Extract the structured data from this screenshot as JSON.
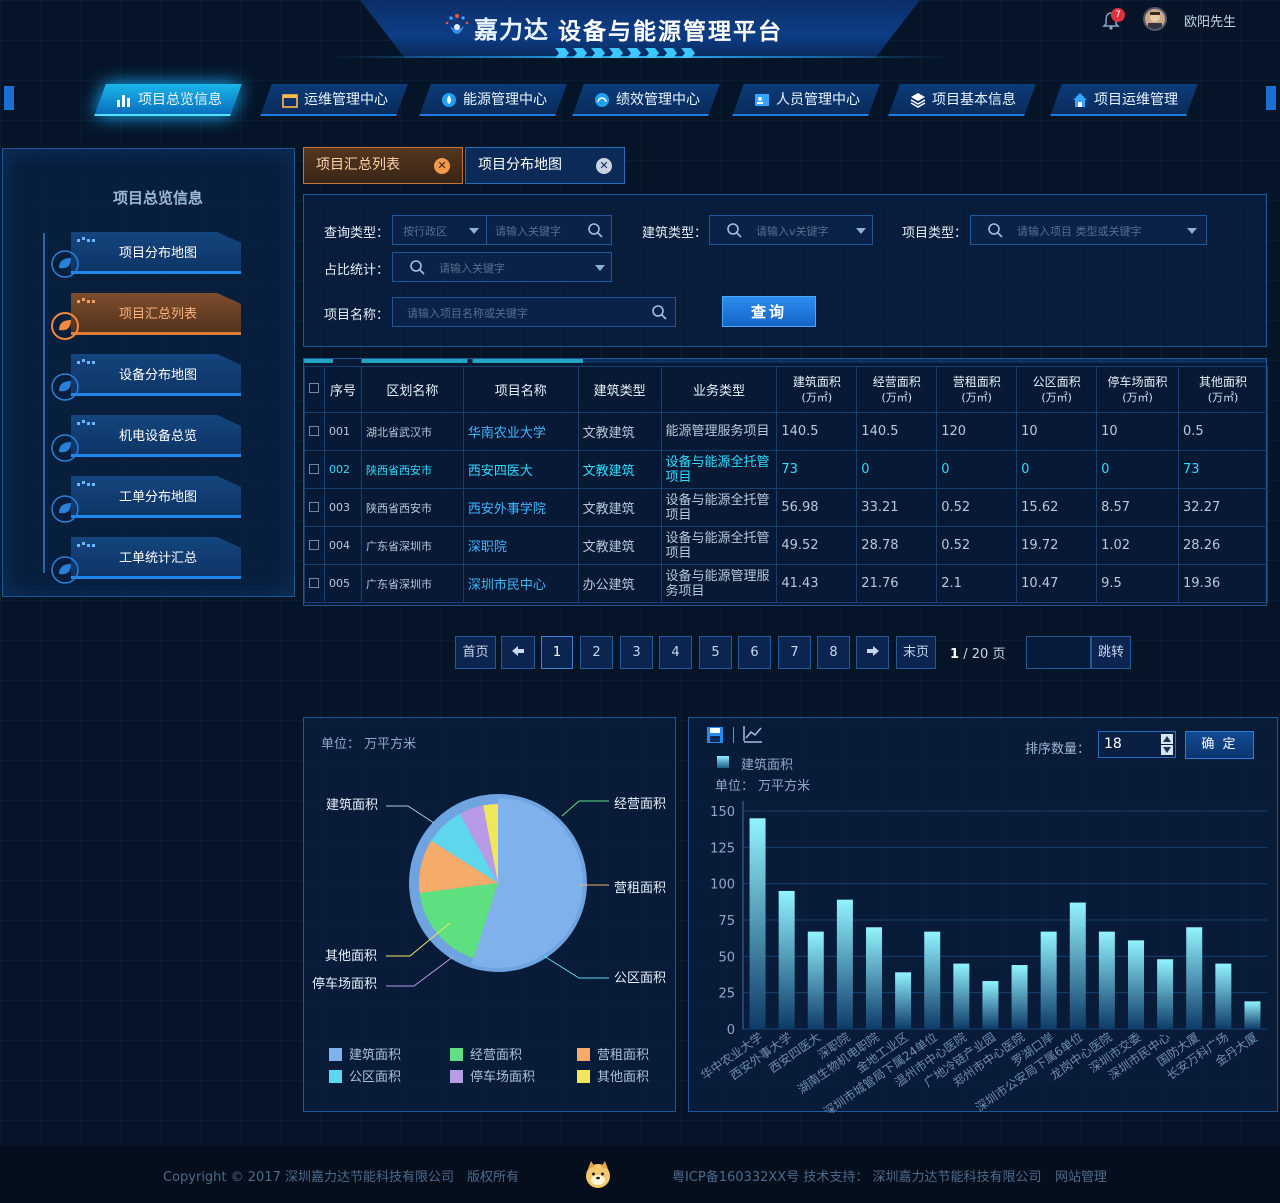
{
  "header": {
    "brand": "嘉力达",
    "title": "设备与能源管理平台",
    "notification_count": "7",
    "username": "欧阳先生"
  },
  "nav": {
    "tabs": [
      {
        "label": "项目总览信息",
        "icon": "chart-bars-icon",
        "active": true
      },
      {
        "label": "运维管理中心",
        "icon": "calendar-icon",
        "active": false
      },
      {
        "label": "能源管理中心",
        "icon": "droplet-icon",
        "active": false
      },
      {
        "label": "绩效管理中心",
        "icon": "gauge-icon",
        "active": false
      },
      {
        "label": "人员管理中心",
        "icon": "person-card-icon",
        "active": false
      },
      {
        "label": "项目基本信息",
        "icon": "layers-icon",
        "active": false
      },
      {
        "label": "项目运维管理",
        "icon": "home-icon",
        "active": false
      }
    ]
  },
  "sidebar": {
    "title": "项目总览信息",
    "items": [
      {
        "label": "项目分布地图",
        "active": false
      },
      {
        "label": "项目汇总列表",
        "active": true
      },
      {
        "label": "设备分布地图",
        "active": false
      },
      {
        "label": "机电设备总览",
        "active": false
      },
      {
        "label": "工单分布地图",
        "active": false
      },
      {
        "label": "工单统计汇总",
        "active": false
      }
    ]
  },
  "content_tabs": [
    {
      "label": "项目汇总列表",
      "active": true
    },
    {
      "label": "项目分布地图",
      "active": false
    }
  ],
  "filters": {
    "query_type_label": "查询类型：",
    "region_placeholder": "按行政区",
    "keyword_placeholder": "请输入关键字",
    "building_type_label": "建筑类型：",
    "building_type_placeholder": "请输入v关键字",
    "project_type_label": "项目类型：",
    "project_type_placeholder": "请输入项目 类型或关键字",
    "ratio_label": "占比统计：",
    "ratio_placeholder": "请输入关键字",
    "name_label": "项目名称：",
    "name_placeholder": "请输入项目名称或关键字",
    "query_button": "查询"
  },
  "table": {
    "headers": [
      "序号",
      "区划名称",
      "项目名称",
      "建筑类型",
      "业务类型"
    ],
    "area_headers": [
      {
        "name": "建筑面积",
        "unit": "(万㎡)"
      },
      {
        "name": "经营面积",
        "unit": "(万㎡)"
      },
      {
        "name": "营租面积",
        "unit": "(万㎡)"
      },
      {
        "name": "公区面积",
        "unit": "(万㎡)"
      },
      {
        "name": "停车场面积",
        "unit": "(万㎡)"
      },
      {
        "name": "其他面积",
        "unit": "(万㎡)"
      }
    ],
    "rows": [
      {
        "no": "001",
        "region": "湖北省武汉市",
        "name": "华南农业大学",
        "building": "文教建筑",
        "business": "能源管理服务项目",
        "a1": "140.5",
        "a2": "140.5",
        "a3": "120",
        "a4": "10",
        "a5": "10",
        "a6": "0.5",
        "highlight": false
      },
      {
        "no": "002",
        "region": "陕西省西安市",
        "name": "西安四医大",
        "building": "文教建筑",
        "business": "设备与能源全托管项目",
        "a1": "73",
        "a2": "0",
        "a3": "0",
        "a4": "0",
        "a5": "0",
        "a6": "73",
        "highlight": true
      },
      {
        "no": "003",
        "region": "陕西省西安市",
        "name": "西安外事学院",
        "building": "文教建筑",
        "business": "设备与能源全托管项目",
        "a1": "56.98",
        "a2": "33.21",
        "a3": "0.52",
        "a4": "15.62",
        "a5": "8.57",
        "a6": "32.27",
        "highlight": false
      },
      {
        "no": "004",
        "region": "广东省深圳市",
        "name": "深职院",
        "building": "文教建筑",
        "business": "设备与能源全托管项目",
        "a1": "49.52",
        "a2": "28.78",
        "a3": "0.52",
        "a4": "19.72",
        "a5": "1.02",
        "a6": "28.26",
        "highlight": false
      },
      {
        "no": "005",
        "region": "广东省深圳市",
        "name": "深圳市民中心",
        "building": "办公建筑",
        "business": "设备与能源管理服务项目",
        "a1": "41.43",
        "a2": "21.76",
        "a3": "2.1",
        "a4": "10.47",
        "a5": "9.5",
        "a6": "19.36",
        "highlight": false
      }
    ]
  },
  "pagination": {
    "first": "首页",
    "last": "末页",
    "pages": [
      "1",
      "2",
      "3",
      "4",
      "5",
      "6",
      "7",
      "8"
    ],
    "current": "1",
    "total": "/ 20 页",
    "jump": "跳转"
  },
  "pie_panel": {
    "unit": "单位： 万平方米",
    "labels": {
      "building": "建筑面积",
      "operating": "经营面积",
      "rental": "营租面积",
      "public": "公区面积",
      "parking": "停车场面积",
      "other": "其他面积"
    },
    "legend": [
      {
        "label": "建筑面积",
        "color": "#7fb2ec"
      },
      {
        "label": "经营面积",
        "color": "#5ee080"
      },
      {
        "label": "营租面积",
        "color": "#f5ab6a"
      },
      {
        "label": "公区面积",
        "color": "#5ed6ee"
      },
      {
        "label": "停车场面积",
        "color": "#b89ae6"
      },
      {
        "label": "其他面积",
        "color": "#f0e65c"
      }
    ]
  },
  "bar_panel": {
    "legend_label": "建筑面积",
    "unit": "单位： 万平方米",
    "rank_label": "排序数量：",
    "rank_value": "18",
    "confirm": "确 定"
  },
  "chart_data": [
    {
      "type": "pie",
      "series": [
        {
          "name": "建筑面积",
          "value": 55,
          "color": "#7fb2ec"
        },
        {
          "name": "经营面积",
          "value": 18,
          "color": "#5ee080"
        },
        {
          "name": "营租面积",
          "value": 11,
          "color": "#f5ab6a"
        },
        {
          "name": "公区面积",
          "value": 8,
          "color": "#5ed6ee"
        },
        {
          "name": "停车场面积",
          "value": 5,
          "color": "#b89ae6"
        },
        {
          "name": "其他面积",
          "value": 3,
          "color": "#f0e65c"
        }
      ]
    },
    {
      "type": "bar",
      "series": [
        {
          "name": "建筑面积"
        }
      ],
      "categories": [
        "华中农业大学",
        "西安外事大学",
        "西安四医大",
        "深职院",
        "湖南生物机电职院",
        "金地工业区",
        "深圳市城管局下属24单位",
        "温州市中心医院",
        "广地冷链产业园",
        "郑州市中心医院",
        "罗湖口岸",
        "深圳市公安局下属6单位",
        "龙岗中心医院",
        "深圳市交委",
        "深圳市民中心",
        "国防大厦",
        "长安万科广场",
        "金丹大厦"
      ],
      "values": [
        145,
        95,
        67,
        89,
        70,
        39,
        67,
        45,
        33,
        44,
        67,
        87,
        67,
        61,
        48,
        70,
        45,
        19
      ],
      "ylim": [
        0,
        150
      ],
      "yticks": [
        "0",
        "25",
        "50",
        "75",
        "100",
        "125",
        "150"
      ]
    }
  ],
  "footer": {
    "copyright": "Copyright © 2017 深圳嘉力达节能科技有限公司",
    "rights": "版权所有",
    "icp": "粤ICP备160332XX号 技术支持： 深圳嘉力达节能科技有限公司",
    "admin": "网站管理"
  }
}
